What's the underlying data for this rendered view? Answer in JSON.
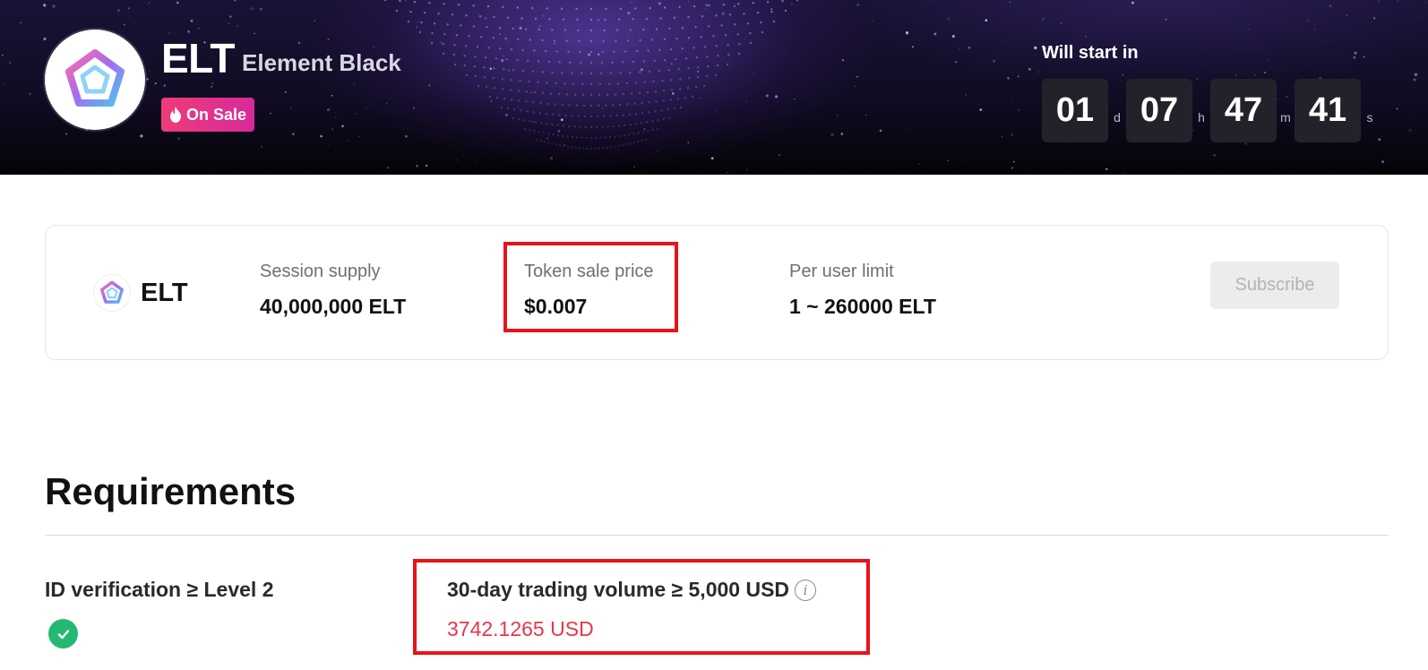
{
  "header": {
    "symbol": "ELT",
    "name": "Element Black",
    "badge": {
      "icon": "flame-icon",
      "label": "On Sale"
    },
    "countdown": {
      "title": "Will start in",
      "days": "01",
      "days_unit": "d",
      "hours": "07",
      "hours_unit": "h",
      "minutes": "47",
      "minutes_unit": "m",
      "seconds": "41",
      "seconds_unit": "s"
    }
  },
  "sale_card": {
    "symbol": "ELT",
    "supply_label": "Session supply",
    "supply_value": "40,000,000 ELT",
    "price_label": "Token sale price",
    "price_value": "$0.007",
    "limit_label": "Per user limit",
    "limit_value": "1 ~ 260000 ELT",
    "subscribe_label": "Subscribe"
  },
  "requirements": {
    "title": "Requirements",
    "items": [
      {
        "label": "ID verification ≥ Level 2",
        "status_icon": "check-circle-icon"
      },
      {
        "label": "30-day trading volume ≥ 5,000 USD",
        "info_icon": "info-icon",
        "current_value": "3742.1265 USD"
      }
    ]
  },
  "colors": {
    "badge": "#e8337f",
    "highlight": "#e8131b",
    "success": "#25b872",
    "warning_value": "#e8364b"
  }
}
